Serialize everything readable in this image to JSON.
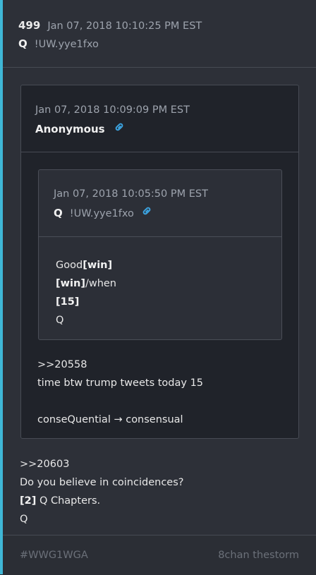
{
  "post": {
    "number": "499",
    "timestamp": "Jan 07, 2018 10:10:25 PM EST",
    "name": "Q",
    "tripcode": "!UW.yye1fxo",
    "body": {
      "line1": ">>20603",
      "line2": "Do you believe in coincidences?",
      "line3_bold": "[2]",
      "line3_rest": " Q Chapters.",
      "line4": "Q"
    }
  },
  "quote1": {
    "timestamp": "Jan 07, 2018 10:09:09 PM EST",
    "name": "Anonymous",
    "link_icon": "link-icon",
    "body": {
      "line1": ">>20558",
      "line2": "time btw trump tweets today 15",
      "line3": "conseQuential → consensual"
    }
  },
  "quote2": {
    "timestamp": "Jan 07, 2018 10:05:50 PM EST",
    "name": "Q",
    "tripcode": "!UW.yye1fxo",
    "link_icon": "link-icon",
    "body": {
      "line1_text": "Good",
      "line1_bold": "[win]",
      "line2_bold": "[win]",
      "line2_text": "/when",
      "line3_bold": "[15]",
      "line4": "Q"
    }
  },
  "footer": {
    "hashtag": "#WWG1WGA",
    "brand": "8chan thestorm"
  },
  "colors": {
    "accent": "#3fb7d6",
    "link_icon": "#3ba3e0",
    "background": "#2d3038"
  }
}
